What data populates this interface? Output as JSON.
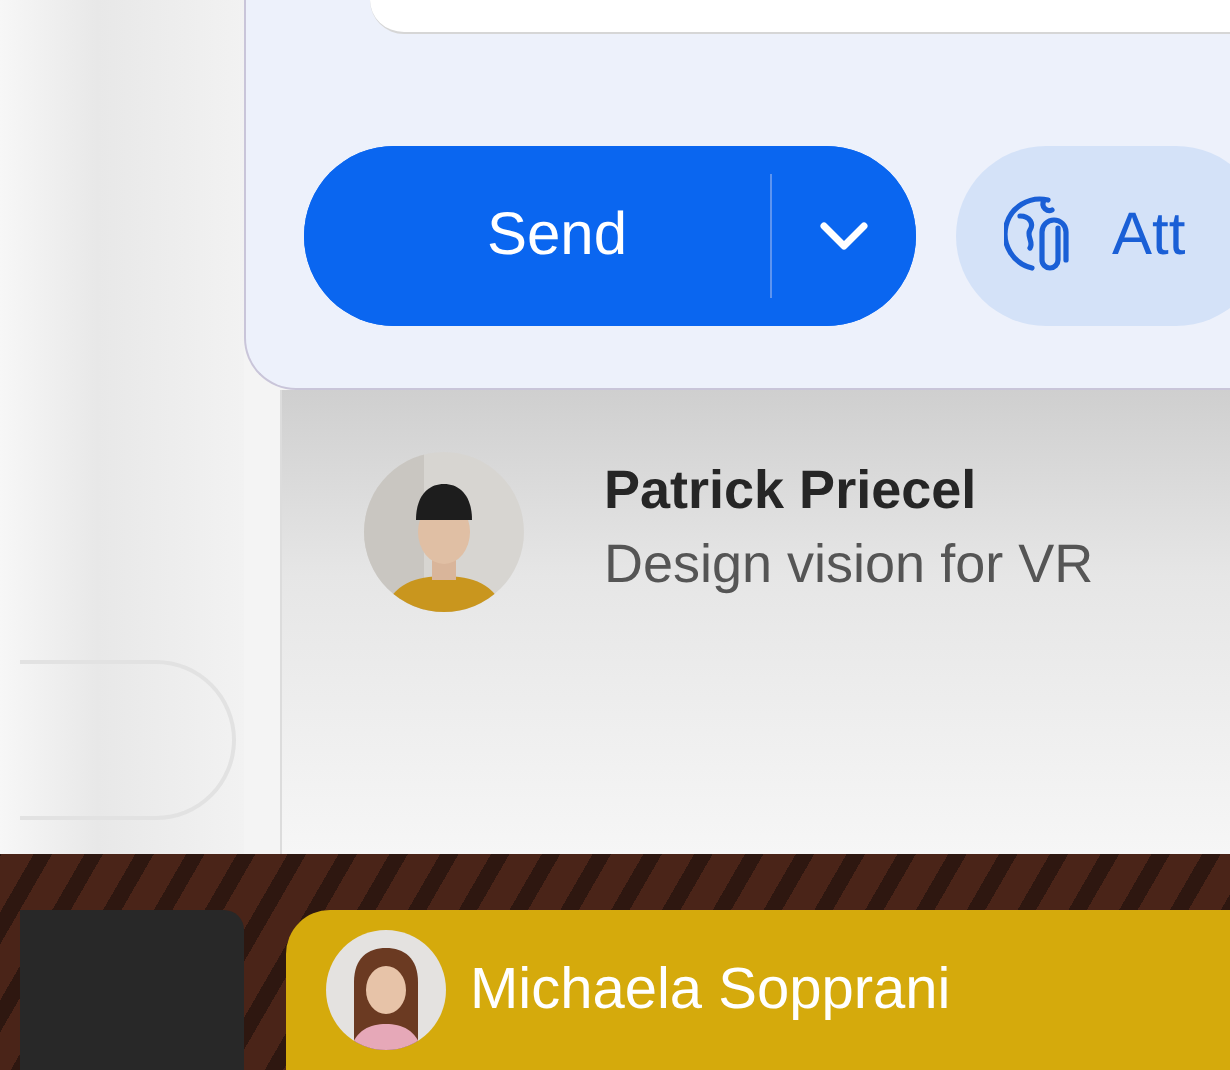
{
  "compose": {
    "send_button": {
      "label": "Send"
    },
    "attach_button": {
      "label": "Att"
    }
  },
  "message": {
    "sender": "Patrick Priecel",
    "preview": "Design vision for VR"
  },
  "highlighted_card": {
    "sender": "Michaela Sopprani"
  }
}
